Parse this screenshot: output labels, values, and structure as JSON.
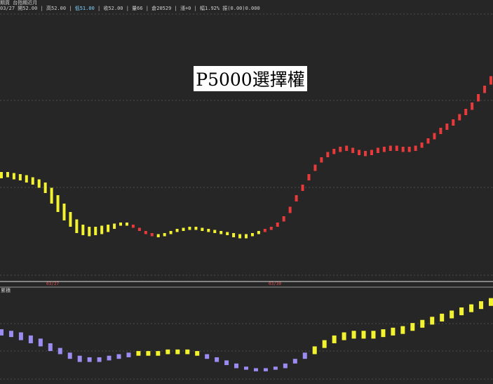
{
  "header": {
    "line1": "期貨 台指期近月",
    "line2_parts": [
      {
        "text": "03/27 開52.00 | 高52.00 | ",
        "highlight": false
      },
      {
        "text": "低51.00",
        "highlight": true
      },
      {
        "text": " | 收52.00 | 量66 | 倉20529 | 漲+0 | 幅1.92% 振(0.00)0.000",
        "highlight": false
      }
    ]
  },
  "banner_text": "P5000選擇權",
  "sub_panel_label": "累積",
  "x_dates": [
    "03/27",
    "03/30"
  ],
  "colors": {
    "background": "#262626",
    "up": "#e83a3a",
    "flat": "#f2f230",
    "down": "#9a8cf0",
    "grid": "#5a5a5a"
  },
  "chart_data": {
    "type": "bar",
    "main": {
      "title": "P5000選擇權",
      "series": [
        {
          "values": [
            280,
            280,
            279,
            278,
            277,
            275,
            273,
            270,
            265,
            258,
            250,
            242,
            235,
            230,
            228,
            228,
            229,
            230,
            231,
            232,
            232,
            230,
            227,
            224,
            222,
            221,
            222,
            224,
            226,
            227,
            228,
            228,
            227,
            226,
            225,
            224,
            223,
            222,
            221,
            221,
            222,
            224,
            226,
            228,
            232,
            238,
            247,
            258,
            268,
            278,
            287,
            294,
            299,
            302,
            304,
            305,
            303,
            301,
            300,
            301,
            303,
            304,
            305,
            305,
            304,
            304,
            305,
            308,
            312,
            317,
            322,
            326,
            330,
            335,
            340,
            346,
            354,
            362,
            371
          ],
          "lows": [
            274,
            275,
            273,
            272,
            270,
            268,
            265,
            260,
            250,
            242,
            234,
            228,
            222,
            220,
            219,
            220,
            221,
            223,
            226,
            229,
            229,
            227,
            224,
            221,
            219,
            218,
            219,
            221,
            223,
            224,
            225,
            225,
            224,
            223,
            222,
            221,
            220,
            218,
            217,
            217,
            219,
            221,
            223,
            225,
            228,
            233,
            241,
            252,
            262,
            272,
            281,
            289,
            294,
            297,
            299,
            300,
            298,
            296,
            295,
            296,
            298,
            299,
            300,
            300,
            299,
            299,
            300,
            303,
            307,
            311,
            316,
            320,
            324,
            329,
            334,
            339,
            347,
            355,
            363
          ]
        }
      ]
    },
    "sub": {
      "title": "累積",
      "values": [
        62,
        61,
        60,
        58,
        56,
        53,
        50,
        47,
        45,
        44,
        44,
        45,
        46,
        47,
        48,
        48,
        48,
        49,
        49,
        49,
        48,
        46,
        44,
        42,
        40,
        38,
        37,
        37,
        38,
        40,
        43,
        47,
        51,
        55,
        58,
        60,
        61,
        61,
        61,
        62,
        63,
        64,
        66,
        68,
        70,
        72,
        74,
        76,
        78,
        80,
        82
      ],
      "lows": [
        58,
        57,
        55,
        53,
        51,
        48,
        46,
        43,
        41,
        41,
        41,
        42,
        43,
        44,
        45,
        45,
        45,
        46,
        46,
        46,
        45,
        43,
        41,
        39,
        37,
        36,
        35,
        35,
        36,
        37,
        40,
        43,
        46,
        50,
        53,
        55,
        56,
        56,
        56,
        57,
        58,
        59,
        61,
        63,
        65,
        67,
        69,
        71,
        73,
        75,
        77
      ]
    }
  }
}
